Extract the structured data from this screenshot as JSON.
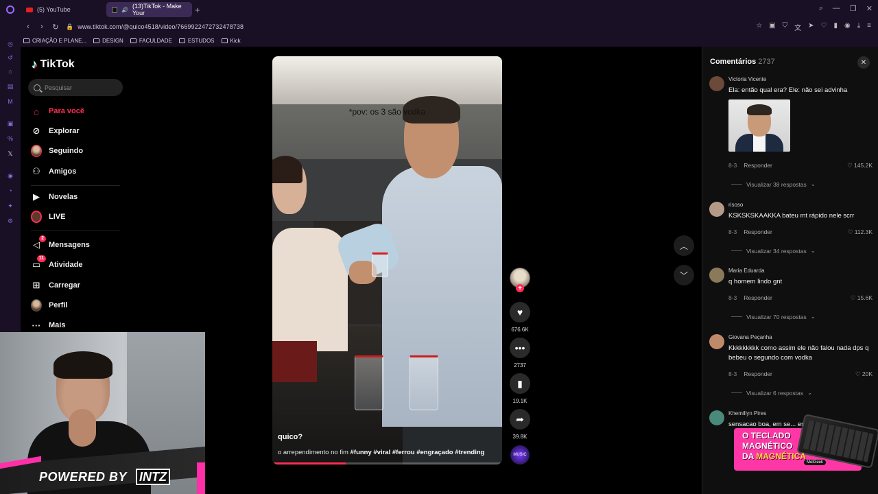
{
  "browser": {
    "tabs": [
      {
        "label": "(5) YouTube",
        "active": false,
        "icon": "youtube-icon"
      },
      {
        "label": "(13)TikTok - Make Your",
        "active": true,
        "icon": "tiktok-icon"
      }
    ],
    "new_tab": "+",
    "url": "www.tiktok.com/@quico4518/video/7669922472732478738",
    "bookmarks": [
      "CRIAÇÃO E PLANE...",
      "DESIGN",
      "FACULDADE",
      "ESTUDOS",
      "Kick"
    ]
  },
  "tiktok": {
    "logo": "TikTok",
    "search": {
      "placeholder": "Pesquisar",
      "value": ""
    },
    "nav": [
      {
        "label": "Para você",
        "icon": "home-icon",
        "active": true
      },
      {
        "label": "Explorar",
        "icon": "compass-icon",
        "active": false
      },
      {
        "label": "Seguindo",
        "icon": "avatar-icon",
        "active": false
      },
      {
        "label": "Amigos",
        "icon": "friends-icon",
        "active": false
      },
      {
        "label": "Novelas",
        "icon": "film-icon",
        "active": false
      },
      {
        "label": "LIVE",
        "icon": "live-icon",
        "active": false
      },
      {
        "label": "Mensagens",
        "icon": "send-icon",
        "badge": "2",
        "active": false
      },
      {
        "label": "Atividade",
        "icon": "inbox-icon",
        "badge": "11",
        "active": false
      },
      {
        "label": "Carregar",
        "icon": "plus-square-icon",
        "active": false
      },
      {
        "label": "Perfil",
        "icon": "profile-icon",
        "active": false
      },
      {
        "label": "Mais",
        "icon": "more-icon",
        "active": false
      }
    ]
  },
  "webcam": {
    "powered_by": "POWERED BY",
    "brand": "INTZ"
  },
  "video": {
    "overlay_text": "*pov: os 3 são vodka",
    "author": "quico?",
    "caption": "o arrependimento no fim",
    "hashtags": "#funny #viral #ferrou #engraçado #trending",
    "progress": 0.32,
    "actions": {
      "likes": "676.6K",
      "comments": "2737",
      "saves": "19.1K",
      "shares": "39.8K",
      "music_label": "MUSIC"
    }
  },
  "comments_panel": {
    "title": "Comentários",
    "count": "2737",
    "items": [
      {
        "user": "Victoria Vicente",
        "text": "Ela: então qual era? Ele: não sei advinha",
        "date": "8-3",
        "reply_label": "Responder",
        "likes": "145.2K",
        "view_replies": "Visualizar 38 respostas",
        "has_image": true,
        "avatar_color": "#6b4a3a"
      },
      {
        "user": "risoso",
        "text": "KSKSKSKAAKKA bateu mt rápido nele scrr",
        "date": "8-3",
        "reply_label": "Responder",
        "likes": "112.3K",
        "view_replies": "Visualizar 34 respostas",
        "avatar_color": "#b59a88"
      },
      {
        "user": "Maria Eduarda",
        "text": "q homem lindo gnt",
        "date": "8-3",
        "reply_label": "Responder",
        "likes": "15.6K",
        "view_replies": "Visualizar 70 respostas",
        "avatar_color": "#8a7a5a"
      },
      {
        "user": "Giovana Peçanha",
        "text": "Kkkkkkkkk como assim ele não falou nada dps q bebeu o segundo com vodka",
        "date": "8-3",
        "reply_label": "Responder",
        "likes": "20K",
        "view_replies": "Visualizar 6 respostas",
        "avatar_color": "#c08a6a"
      },
      {
        "user": "Khemillyn Pires",
        "text": "sensacao boa, em se... esa brincadeira",
        "avatar_color": "#4a8a7a"
      }
    ]
  },
  "ad": {
    "line1": "O TECLADO",
    "line2": "MAGNÉTICO",
    "line3_prefix": "DA",
    "line3_highlight": "MAGNÉTICA",
    "brand": "MelGeek"
  }
}
